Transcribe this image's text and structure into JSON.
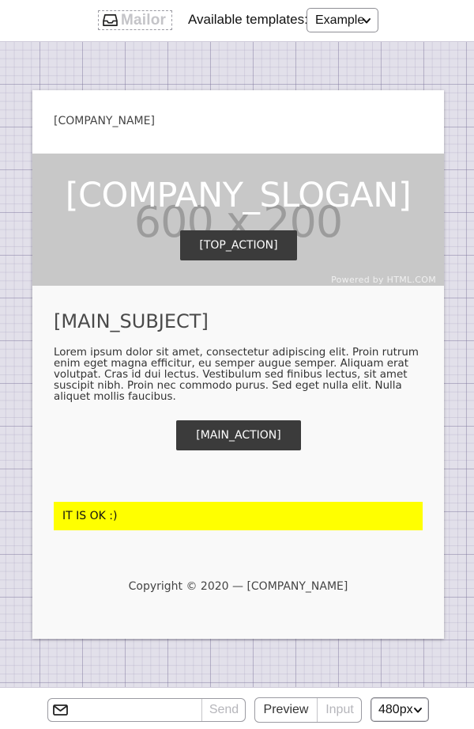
{
  "app": {
    "logo_text": "Mailor",
    "logo_icon": "inbox-tray-icon"
  },
  "toolbar": {
    "templates_label": "Available templates:",
    "template_selected": "Example"
  },
  "email": {
    "company_name": "[COMPANY_NAME]",
    "hero": {
      "slogan": "[COMPANY_SLOGAN]",
      "placeholder_dimensions": "600 x 200",
      "top_action": "[TOP_ACTION]",
      "powered_by": "Powered by HTML.COM",
      "background_color": "#c8c8c8"
    },
    "main_subject": "[MAIN_SUBJECT]",
    "body": "Lorem ipsum dolor sit amet, consectetur adipiscing elit. Proin rutrum enim eget magna efficitur, eu semper augue semper. Aliquam erat volutpat. Cras id dui lectus. Vestibulum sed finibus lectus, sit amet suscipit nibh. Proin nec commodo purus. Sed eget nulla elit. Nulla aliquet mollis faucibus.",
    "main_action": "[MAIN_ACTION]",
    "notice": "IT IS OK :)",
    "notice_color": "#ffff00",
    "copyright": "Copyright © 2020 — [COMPANY_NAME]"
  },
  "bottombar": {
    "email_icon": "envelope-icon",
    "email_value": "",
    "send_label": "Send",
    "preview_label": "Preview",
    "input_label": "Input",
    "width_selected": "480px"
  }
}
